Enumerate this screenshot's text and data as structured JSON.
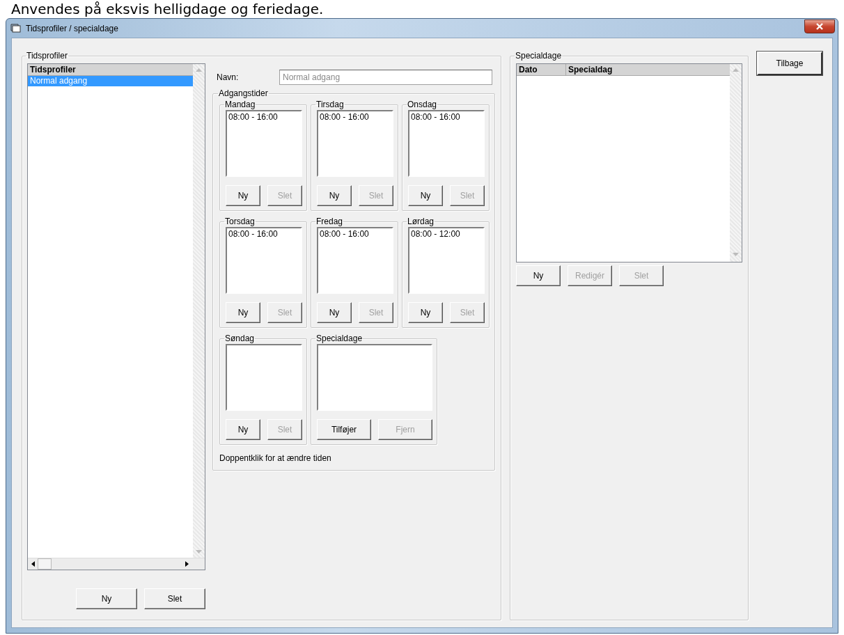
{
  "caption": "Anvendes på eksvis helligdage og feriedage.",
  "window": {
    "title": "Tidsprofiler / specialdage"
  },
  "profiles": {
    "title": "Tidsprofiler",
    "column": "Tidsprofiler",
    "rows": [
      {
        "name": "Normal adgang",
        "selected": true
      }
    ],
    "buttons": [
      {
        "label": "Ny",
        "disabled": false
      },
      {
        "label": "Slet",
        "disabled": false
      }
    ]
  },
  "name_field": {
    "label": "Navn:",
    "value": "Normal adgang",
    "disabled": true
  },
  "access_times": {
    "title": "Adgangstider",
    "days": [
      {
        "kind": "day",
        "title": "Mandag",
        "entries": [
          "08:00 - 16:00"
        ],
        "buttons": [
          {
            "label": "Ny",
            "disabled": false
          },
          {
            "label": "Slet",
            "disabled": true
          }
        ]
      },
      {
        "kind": "day",
        "title": "Tirsdag",
        "entries": [
          "08:00 - 16:00"
        ],
        "buttons": [
          {
            "label": "Ny",
            "disabled": false
          },
          {
            "label": "Slet",
            "disabled": true
          }
        ]
      },
      {
        "kind": "day",
        "title": "Onsdag",
        "entries": [
          "08:00 - 16:00"
        ],
        "buttons": [
          {
            "label": "Ny",
            "disabled": false
          },
          {
            "label": "Slet",
            "disabled": true
          }
        ]
      },
      {
        "kind": "day",
        "title": "Torsdag",
        "entries": [
          "08:00 - 16:00"
        ],
        "buttons": [
          {
            "label": "Ny",
            "disabled": false
          },
          {
            "label": "Slet",
            "disabled": true
          }
        ]
      },
      {
        "kind": "day",
        "title": "Fredag",
        "entries": [
          "08:00 - 16:00"
        ],
        "buttons": [
          {
            "label": "Ny",
            "disabled": false
          },
          {
            "label": "Slet",
            "disabled": true
          }
        ]
      },
      {
        "kind": "day",
        "title": "Lørdag",
        "entries": [
          "08:00 - 12:00"
        ],
        "buttons": [
          {
            "label": "Ny",
            "disabled": false
          },
          {
            "label": "Slet",
            "disabled": true
          }
        ]
      },
      {
        "kind": "day",
        "title": "Søndag",
        "buttons": [
          {
            "label": "Ny",
            "disabled": false
          },
          {
            "label": "Slet",
            "disabled": true
          }
        ]
      },
      {
        "kind": "special",
        "title": "Specialdage",
        "buttons": [
          {
            "label": "Tilføjer",
            "disabled": false
          },
          {
            "label": "Fjern",
            "disabled": true
          }
        ]
      }
    ],
    "hint": "Doppentklik for at ændre tiden"
  },
  "special_days": {
    "title": "Specialdage",
    "columns": [
      "Dato",
      "Specialdag"
    ],
    "buttons": [
      {
        "label": "Ny",
        "disabled": false
      },
      {
        "label": "Redigér",
        "disabled": true
      },
      {
        "label": "Slet",
        "disabled": true
      }
    ]
  },
  "back_button": {
    "label": "Tilbage"
  }
}
